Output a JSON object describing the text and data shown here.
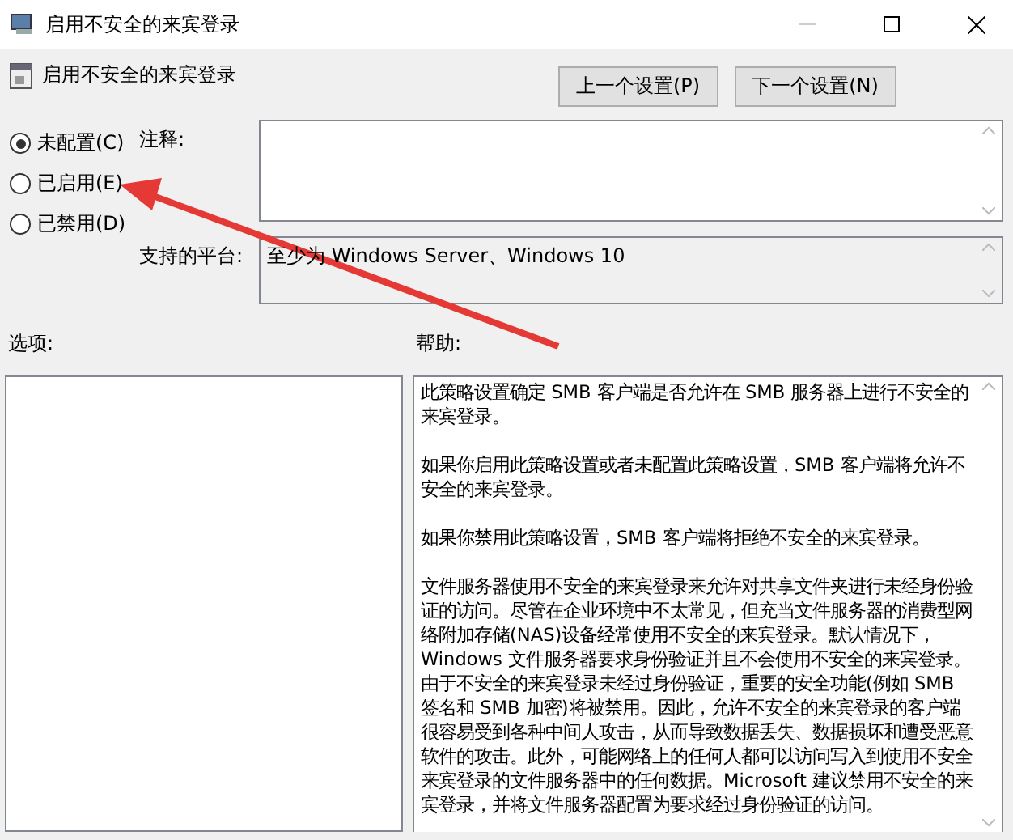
{
  "window": {
    "title": "启用不安全的来宾登录"
  },
  "header": {
    "title": "启用不安全的来宾登录",
    "buttons": [
      "上一个设置(P)",
      "下一个设置(N)"
    ]
  },
  "radios": [
    {
      "label": "未配置(C)",
      "selected": true
    },
    {
      "label": "已启用(E)",
      "selected": false
    },
    {
      "label": "已禁用(D)",
      "selected": false
    }
  ],
  "comment": {
    "label": "注释:"
  },
  "platform": {
    "label": "支持的平台:",
    "value": "至少为 Windows Server、Windows 10"
  },
  "options": {
    "label": "选项:"
  },
  "help": {
    "label": "帮助:",
    "paragraphs": [
      "此策略设置确定 SMB 客户端是否允许在 SMB 服务器上进行不安全的来宾登录。",
      "如果你启用此策略设置或者未配置此策略设置，SMB 客户端将允许不安全的来宾登录。",
      "如果你禁用此策略设置，SMB 客户端将拒绝不安全的来宾登录。",
      "文件服务器使用不安全的来宾登录来允许对共享文件夹进行未经身份验证的访问。尽管在企业环境中不太常见，但充当文件服务器的消费型网络附加存储(NAS)设备经常使用不安全的来宾登录。默认情况下，Windows 文件服务器要求身份验证并且不会使用不安全的来宾登录。由于不安全的来宾登录未经过身份验证，重要的安全功能(例如 SMB 签名和 SMB 加密)将被禁用。因此，允许不安全的来宾登录的客户端很容易受到各种中间人攻击，从而导致数据丢失、数据损坏和遭受恶意软件的攻击。此外，可能网络上的任何人都可以访问写入到使用不安全来宾登录的文件服务器中的任何数据。Microsoft 建议禁用不安全的来宾登录，并将文件服务器配置为要求经过身份验证的访问。"
    ]
  }
}
